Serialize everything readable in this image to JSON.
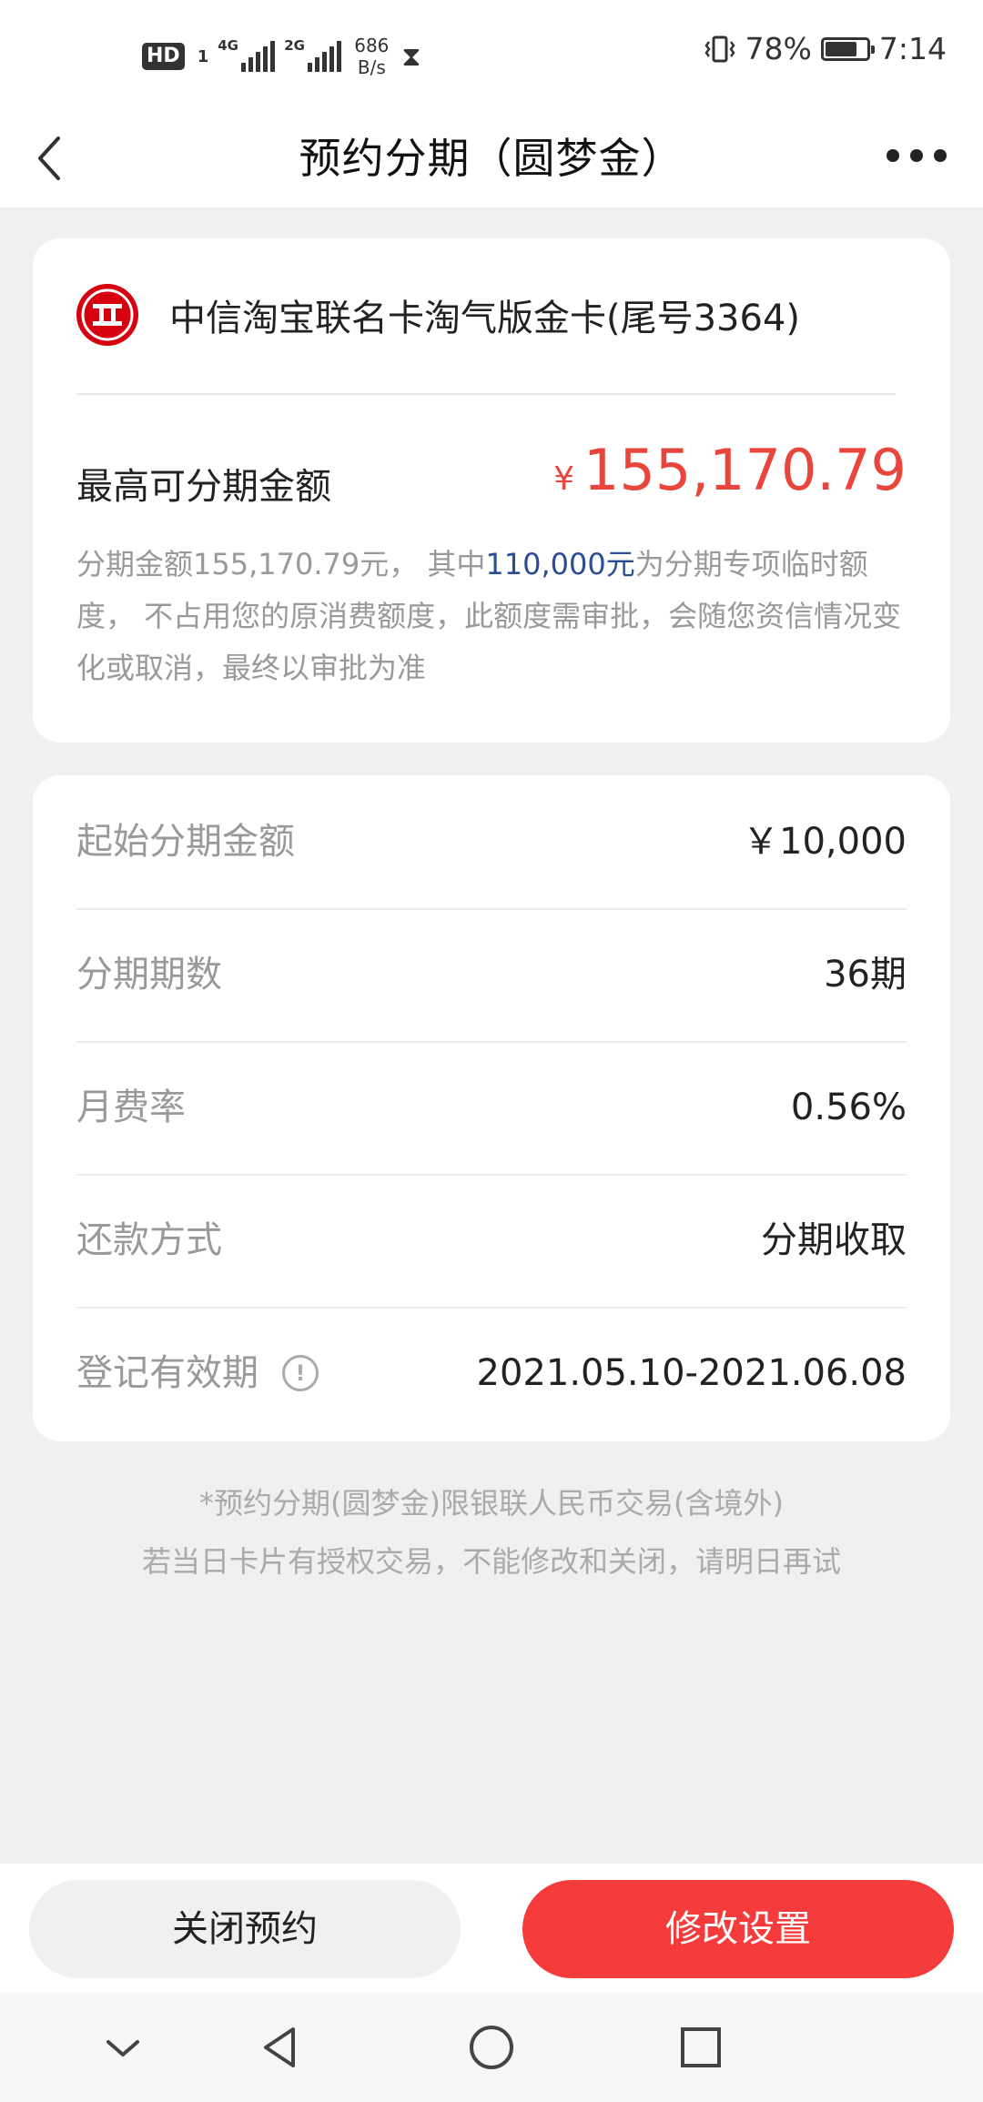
{
  "status_bar": {
    "hd_label": "HD",
    "sim_label": "1",
    "net1": "4G",
    "net2": "2G",
    "speed_value": "686",
    "speed_unit": "B/s",
    "battery_percent": "78%",
    "battery_level": 0.78,
    "time": "7:14",
    "icons": [
      "hourglass-icon",
      "vibrate-icon",
      "battery-icon"
    ]
  },
  "header": {
    "title": "预约分期（圆梦金）",
    "icons": [
      "back-arrow-icon",
      "more-dots-icon"
    ]
  },
  "card_info": {
    "bank_name": "中信淘宝联名卡淘气版金卡(尾号3364)",
    "bank_logo_icon": "citic-bank-logo",
    "max_label": "最高可分期金额",
    "currency": "¥",
    "max_amount": "155,170.79",
    "desc_part1": "分期金额155,170.79元， 其中",
    "desc_highlight": "110,000元",
    "desc_part2": "为分期专项临时额度， 不占用您的原消费额度，此额度需审批，会随您资信情况变化或取消，最终以审批为准"
  },
  "details": {
    "rows": [
      {
        "label": "起始分期金额",
        "value": "￥10,000"
      },
      {
        "label": "分期期数",
        "value": "36期"
      },
      {
        "label": "月费率",
        "value": "0.56%"
      },
      {
        "label": "还款方式",
        "value": "分期收取"
      },
      {
        "label": "登记有效期",
        "value": "2021.05.10-2021.06.08"
      }
    ],
    "info_glyph": "!"
  },
  "notes": {
    "line1": "*预约分期(圆梦金)限银联人民币交易(含境外)",
    "line2": "若当日卡片有授权交易，不能修改和关闭，请明日再试"
  },
  "actions": {
    "close_label": "关闭预约",
    "modify_label": "修改设置"
  },
  "colors": {
    "accent_red": "#f53b3b",
    "amount_red": "#e8453c",
    "highlight_blue": "#2b4d94",
    "background": "#f0f0f0"
  },
  "nav_bar": {
    "icons": [
      "chevron-down-icon",
      "back-triangle-icon",
      "home-circle-icon",
      "recents-square-icon"
    ]
  }
}
